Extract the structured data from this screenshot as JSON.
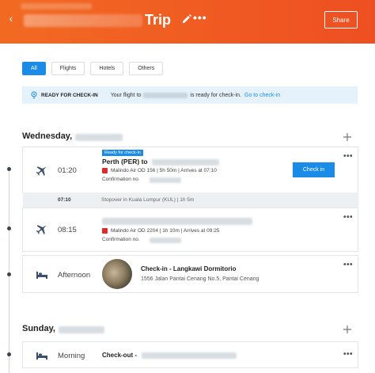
{
  "header": {
    "title": "Trip",
    "more_label": "•••",
    "share_label": "Share",
    "back_label": "‹"
  },
  "filters": [
    {
      "label": "All",
      "active": true
    },
    {
      "label": "Flights",
      "active": false
    },
    {
      "label": "Hotels",
      "active": false
    },
    {
      "label": "Others",
      "active": false
    }
  ],
  "banner": {
    "label": "READY FOR CHECK-IN",
    "text_before": "Your flight to",
    "text_after": "is ready for check-in.",
    "link": "Go to check-in"
  },
  "days": [
    {
      "heading": "Wednesday,"
    },
    {
      "heading": "Sunday,"
    }
  ],
  "flight1": {
    "badge": "Ready for check-in",
    "time": "01:20",
    "route": "Perth (PER) to",
    "details": "Malindo Air OD 156 | 5h 50m | Arrives at 07:10",
    "confirmation": "Confirmation no.",
    "button": "Check in",
    "more": "•••"
  },
  "stopover": {
    "time": "07:10",
    "text": "Stopover in Kuala Lumpur (KUL) | 1h 5m"
  },
  "flight2": {
    "time": "08:15",
    "details": "Malindo Air OD 2204 | 1h 10m | Arrives at 09:25",
    "confirmation": "Confirmation no.",
    "more": "•••"
  },
  "hotel_checkin": {
    "time": "Afternoon",
    "name": "Check-in - Langkawi Dormitorio",
    "address": "1556 Jalan Pantai Cenang No.5, Pantai Cenang",
    "more": "•••"
  },
  "hotel_checkout": {
    "time": "Morning",
    "name": "Check-out -",
    "more": "•••"
  },
  "colors": {
    "header_start": "#f26a22",
    "header_end": "#ee4f22",
    "accent_blue": "#1a8ce8",
    "banner_bg": "#e5f1fb"
  }
}
